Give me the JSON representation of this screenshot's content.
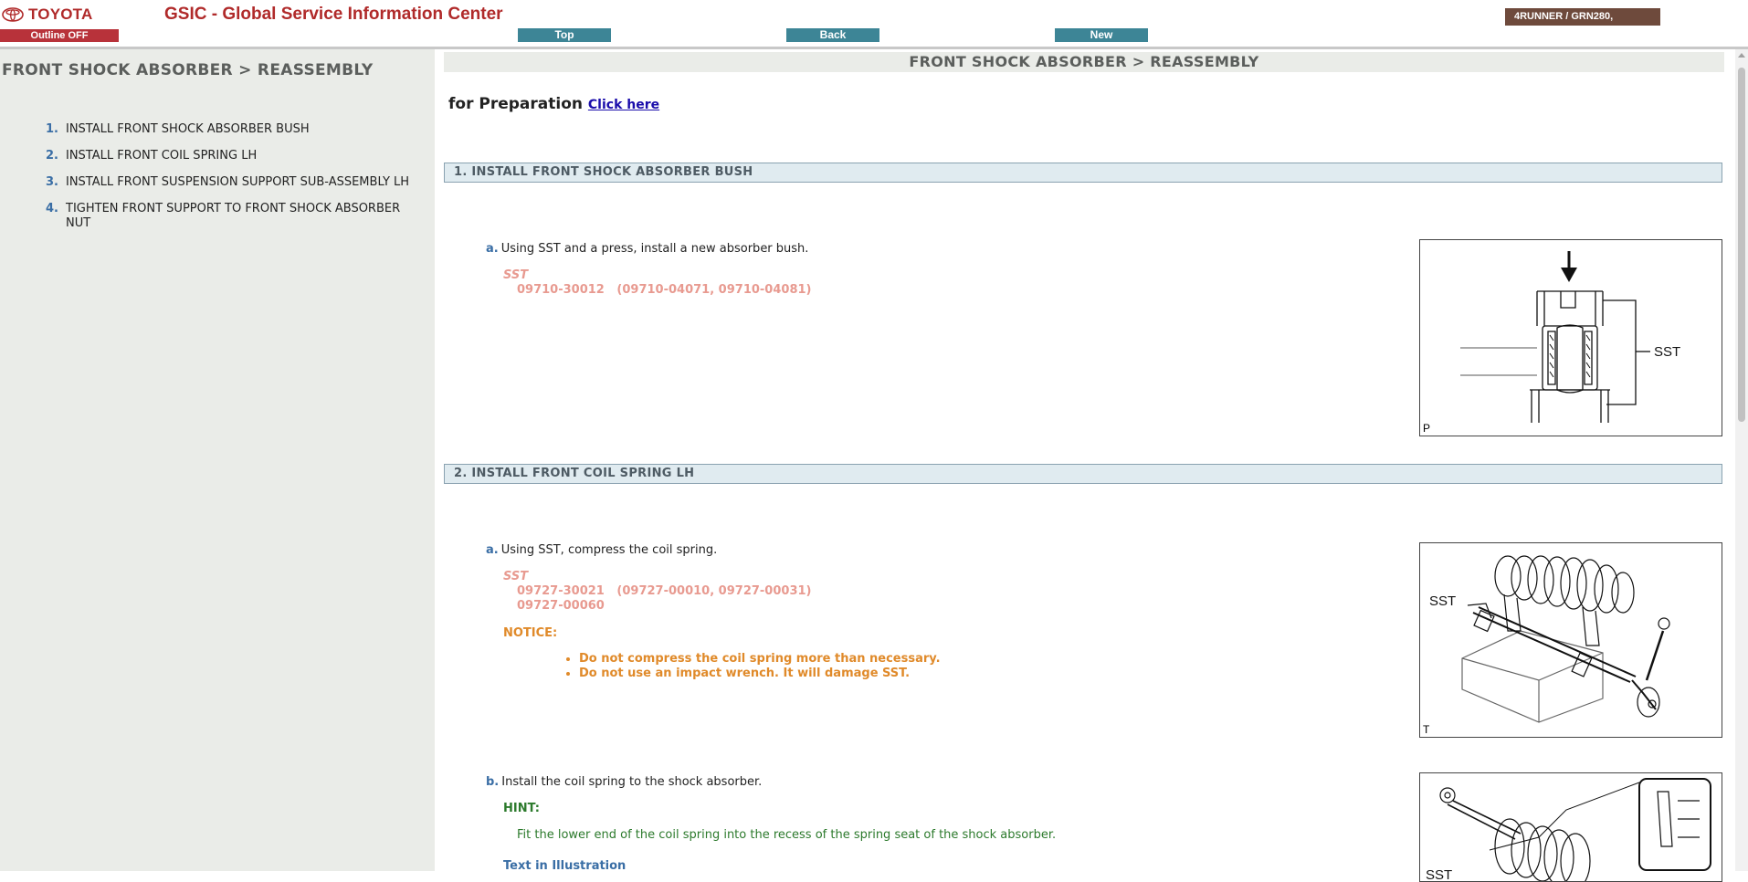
{
  "header": {
    "brand": "TOYOTA",
    "title": "GSIC - Global Service Information Center",
    "outline_toggle": "Outline OFF",
    "nav": {
      "top": "Top",
      "back": "Back",
      "new": "New"
    },
    "vehicle": "4RUNNER / GRN280,"
  },
  "sidebar": {
    "title": "FRONT SHOCK ABSORBER > REASSEMBLY",
    "items": [
      {
        "num": "1.",
        "label": "INSTALL FRONT SHOCK ABSORBER BUSH"
      },
      {
        "num": "2.",
        "label": "INSTALL FRONT COIL SPRING LH"
      },
      {
        "num": "3.",
        "label": "INSTALL FRONT SUSPENSION SUPPORT SUB-ASSEMBLY LH"
      },
      {
        "num": "4.",
        "label": "TIGHTEN FRONT SUPPORT TO FRONT SHOCK ABSORBER NUT"
      }
    ]
  },
  "main": {
    "title": "FRONT SHOCK ABSORBER > REASSEMBLY",
    "prep_text": "for Preparation",
    "prep_link": "Click here",
    "sections": [
      {
        "header": "1. INSTALL FRONT SHOCK ABSORBER BUSH",
        "steps": [
          {
            "letter": "a.",
            "text": "Using SST and a press, install a new absorber bush.",
            "sst_label": "SST",
            "sst_lines": [
              "09710-30012   (09710-04071, 09710-04081)"
            ],
            "figure_label": "SST",
            "figure_tag": "P"
          }
        ]
      },
      {
        "header": "2. INSTALL FRONT COIL SPRING LH",
        "steps": [
          {
            "letter": "a.",
            "text": "Using SST, compress the coil spring.",
            "sst_label": "SST",
            "sst_lines": [
              "09727-30021   (09727-00010, 09727-00031)",
              "09727-00060"
            ],
            "notice_label": "NOTICE:",
            "notices": [
              "Do not compress the coil spring more than necessary.",
              "Do not use an impact wrench. It will damage SST."
            ],
            "figure_label": "SST",
            "figure_tag": "T"
          },
          {
            "letter": "b.",
            "text": "Install the coil spring to the shock absorber.",
            "hint_label": "HINT:",
            "hint_text": "Fit the lower end of the coil spring into the recess of the spring seat of the shock absorber.",
            "text_in_illustration": "Text in Illustration",
            "figure_label": "SST"
          }
        ]
      }
    ]
  },
  "colors": {
    "brand_red": "#b02a2a",
    "nav_teal": "#3d8596",
    "vehicle_brown": "#6e4a3c",
    "sst_pink": "#e89a90",
    "notice_orange": "#e08a2a",
    "hint_green": "#2c7a2c",
    "step_blue": "#3a6ea5"
  }
}
